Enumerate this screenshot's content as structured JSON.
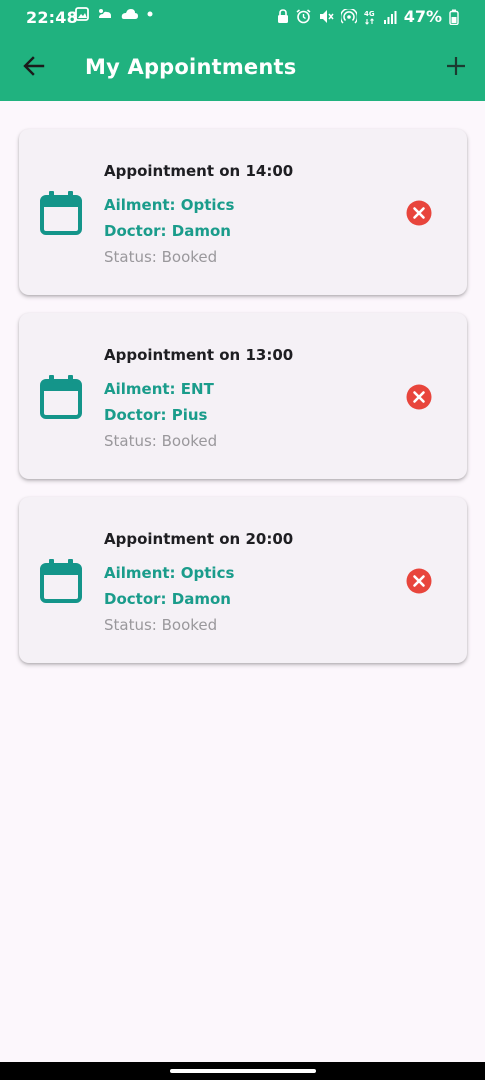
{
  "status_bar": {
    "time": "22:48",
    "battery": "47%",
    "left_icons": [
      "image-icon",
      "weather-icon",
      "cloud-icon",
      "dot-icon"
    ],
    "right_icons": [
      "lock-icon",
      "alarm-icon",
      "mute-icon",
      "hotspot-icon",
      "4g-icon",
      "signal-icon",
      "battery-icon"
    ]
  },
  "app_bar": {
    "title": "My Appointments",
    "back_icon": "arrow-left-icon",
    "add_icon": "plus-icon"
  },
  "appointments": [
    {
      "title": "Appointment on 14:00",
      "ailment": "Ailment: Optics",
      "doctor": "Doctor: Damon",
      "status": "Status: Booked"
    },
    {
      "title": "Appointment on 13:00",
      "ailment": "Ailment: ENT",
      "doctor": "Doctor: Pius",
      "status": "Status: Booked"
    },
    {
      "title": "Appointment on 20:00",
      "ailment": "Ailment: Optics",
      "doctor": "Doctor: Damon",
      "status": "Status: Booked"
    }
  ],
  "colors": {
    "primary": "#20b27f",
    "accent_text": "#1a9c8b",
    "icon_teal": "#14958a",
    "cancel": "#e8453c",
    "background": "#fcf7fc",
    "card": "#f5f1f6"
  }
}
